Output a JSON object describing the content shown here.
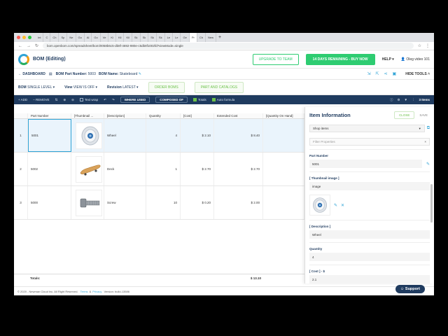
{
  "browser": {
    "tabs": [
      "Int",
      "C",
      "Ch",
      "Sp",
      "Ne",
      "Go",
      "Al",
      "Go",
      "Ve",
      "Ki",
      "Kil",
      "Kil",
      "Sk",
      "Sk",
      "Sk",
      "Sk",
      "Le",
      "Le",
      "Ge",
      "Pr",
      "Ch",
      "New"
    ],
    "url": "bom.openbom.com/spreadsheet/bom/0058b6c5-db8f-4692-980e-c5db8f1002fd?viewMode=single"
  },
  "header": {
    "title": "BOM (Editing)",
    "upgrade_label": "UPGRADE TO TEAM",
    "trial_label": "14 DAYS REMAINING - BUY NOW",
    "help_label": "HELP",
    "user_label": "Oleg video 101"
  },
  "crumbs": {
    "dashboard": "DASHBOARD",
    "part_number_label": "BOM Part Number:",
    "part_number_value": "5003",
    "bom_name_label": "BOM Name:",
    "bom_name_value": "Skateboard",
    "hide_tools": "HIDE TOOLS"
  },
  "filters": {
    "bom_label": "BOM",
    "bom_value": "SINGLE LEVEL",
    "view_label": "View",
    "view_value": "VIEW IS OFF",
    "revision_label": "Revision",
    "revision_value": "LATEST",
    "order_boms": "ORDER BOMS",
    "part_catalogs": "PART AND CATALOGS"
  },
  "toolbar": {
    "add": "ADD",
    "remove": "REMOVE",
    "text_wrap": "Text wrap",
    "where_used": "WHERE USED",
    "composed_of": "COMPOSED OF",
    "totals": "Totals",
    "auto_formula": "Auto formula",
    "items_count": "3 Items"
  },
  "table": {
    "columns": [
      "",
      "Part Number",
      "[Thumbnail ...",
      "[Description]",
      "Quantity",
      "[Cost]",
      "Extended Cost",
      "[Quantity On Hand]"
    ],
    "rows": [
      {
        "idx": "1",
        "part": "5001",
        "desc": "Wheel",
        "qty": "4",
        "cost": "$ 2.10",
        "ext": "$ 8.40"
      },
      {
        "idx": "2",
        "part": "5002",
        "desc": "Deck",
        "qty": "1",
        "cost": "$ 2.70",
        "ext": "$ 2.70"
      },
      {
        "idx": "3",
        "part": "5000",
        "desc": "Screw",
        "qty": "10",
        "cost": "$ 0.20",
        "ext": "$ 2.00"
      }
    ],
    "totals_label": "Totals:",
    "totals_value": "$ 13.10"
  },
  "panel": {
    "title": "Item Information",
    "close": "CLOSE",
    "save": "SAVE",
    "select": "Shop items",
    "filter_placeholder": "Filter Properties",
    "part_number_label": "Part Number",
    "part_number_value": "5001",
    "thumbnail_label": "[ Thumbnail image ]",
    "thumbnail_value": "image",
    "description_label": "[ Description ]",
    "description_value": "Wheel",
    "quantity_label": "Quantity",
    "quantity_value": "4",
    "cost_label": "[ Cost ] - $",
    "cost_value": "2.1"
  },
  "footer": {
    "copyright": "© 2020 - Newman Cloud Inc. All Right Reserved.",
    "terms": "Terms",
    "amp": "&",
    "privacy": "Privacy",
    "version": "Version: build-13586",
    "support": "Support"
  }
}
